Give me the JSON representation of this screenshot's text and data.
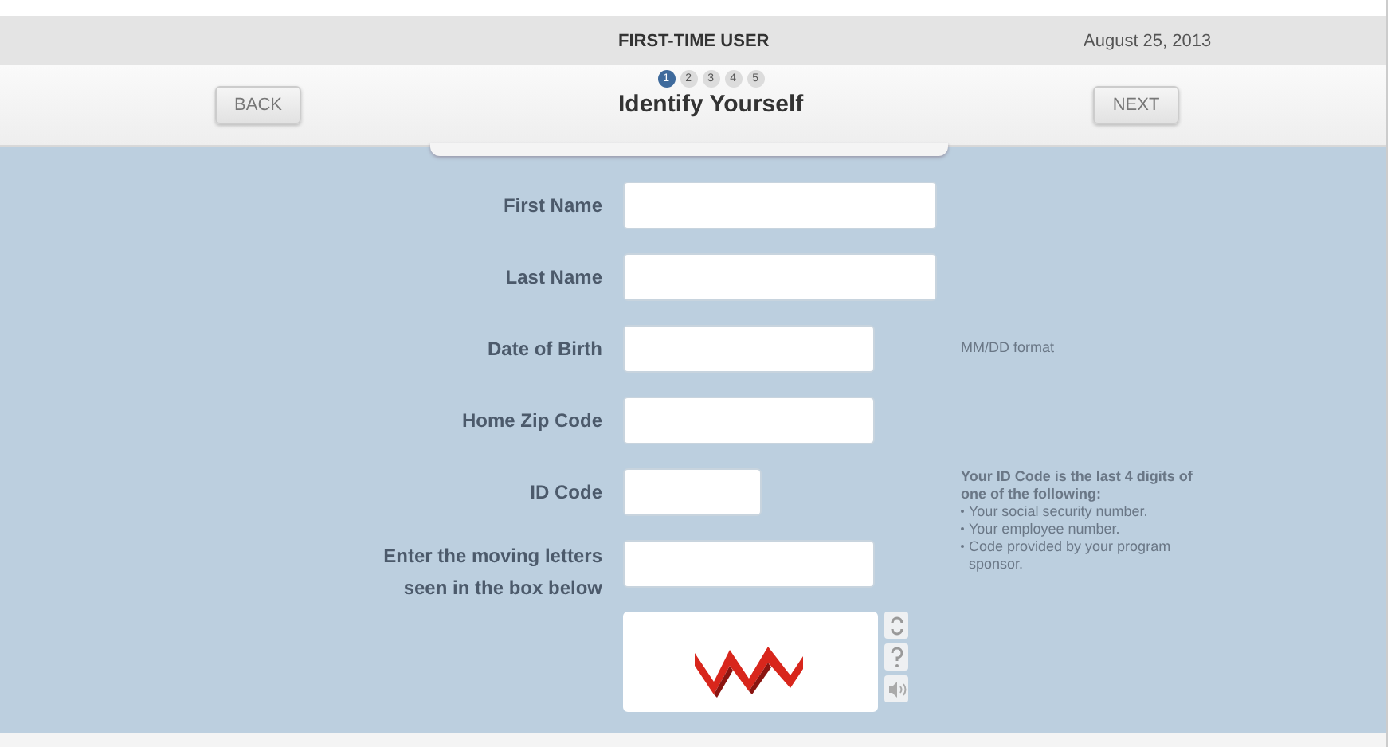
{
  "header": {
    "title": "FIRST-TIME USER",
    "date": "August 25, 2013"
  },
  "nav": {
    "back": "BACK",
    "next": "NEXT",
    "title": "Identify Yourself",
    "steps": [
      {
        "label": "1",
        "selected": true
      },
      {
        "label": "2",
        "selected": false
      },
      {
        "label": "3",
        "selected": false
      },
      {
        "label": "4",
        "selected": false
      },
      {
        "label": "5",
        "selected": false
      }
    ]
  },
  "fields": [
    {
      "label": "First Name",
      "kind": "long"
    },
    {
      "label": "Last Name",
      "kind": "long"
    },
    {
      "label": "Date of Birth",
      "kind": "medium",
      "hint": "MM/DD format"
    },
    {
      "label": "Home Zip Code",
      "kind": "medium"
    },
    {
      "label": "ID Code",
      "kind": "short"
    },
    {
      "label": "Enter the moving letters seen in the box below",
      "kind": "medium"
    }
  ],
  "id_help": {
    "title": "Your ID Code is the last 4 digits of one of the following:",
    "items": [
      "Your social security number.",
      "Your employee number.",
      "Code provided by your program sponsor."
    ]
  }
}
